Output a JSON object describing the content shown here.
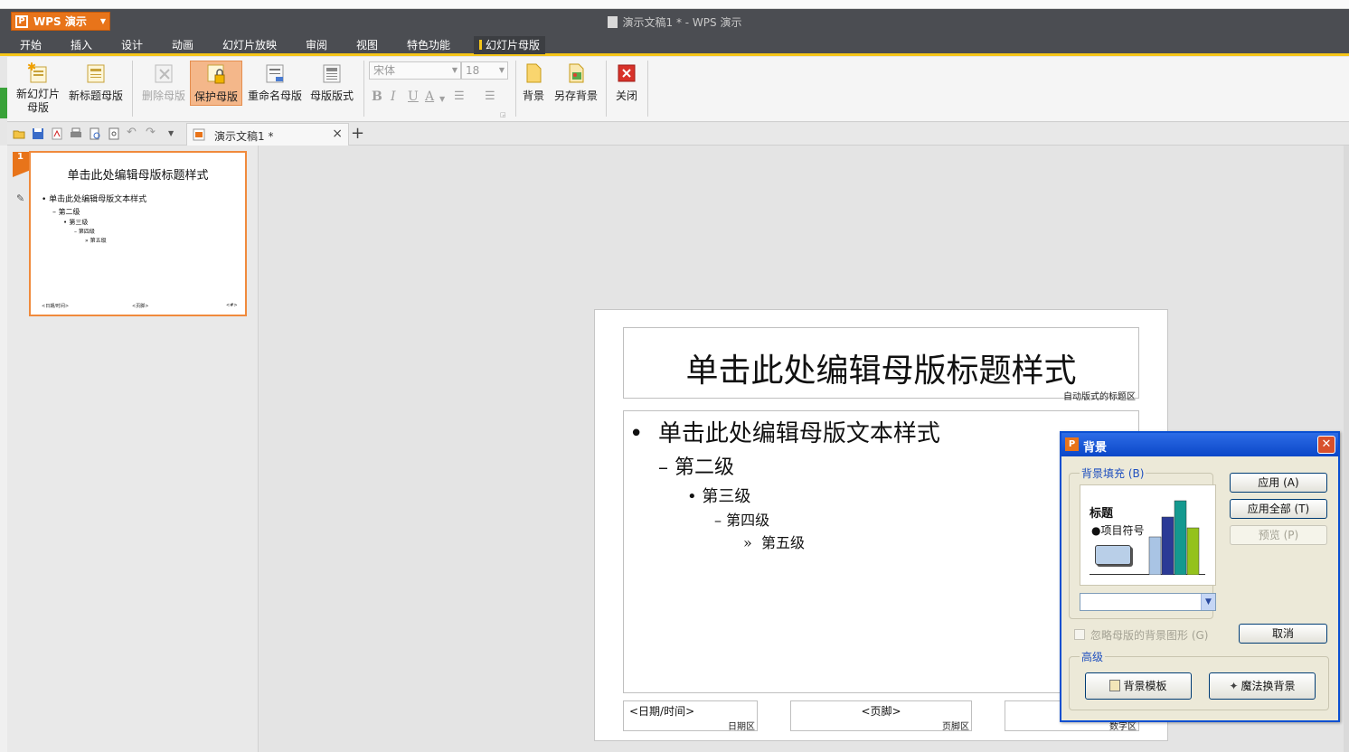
{
  "app": {
    "name": "WPS 演示",
    "window_title": "演示文稿1 * - WPS 演示"
  },
  "menu": {
    "tabs": [
      "开始",
      "插入",
      "设计",
      "动画",
      "幻灯片放映",
      "审阅",
      "视图",
      "特色功能",
      "幻灯片母版"
    ],
    "active_tab": "幻灯片母版"
  },
  "ribbon": {
    "new_slide_master": "新幻灯片母版",
    "new_title_master": "新标题母版",
    "delete_master": "删除母版",
    "protect_master": "保护母版",
    "rename_master": "重命名母版",
    "master_layout": "母版版式",
    "font_name": "宋体",
    "font_size": "18",
    "bold": "B",
    "italic": "I",
    "underline": "U",
    "font_color": "A",
    "background": "背景",
    "save_background": "另存背景",
    "close": "关闭"
  },
  "doc_tab": {
    "label": "演示文稿1 *",
    "close": "×",
    "add": "+"
  },
  "thumbnail": {
    "number": "1",
    "title": "单击此处编辑母版标题样式",
    "level1": "单击此处编辑母版文本样式",
    "level2": "第二级",
    "level3": "第三级",
    "level4": "第四级",
    "level5": "第五级",
    "foot_date": "<日期/时间>",
    "foot_footer": "<页脚>",
    "foot_num": "<#>"
  },
  "slide": {
    "title": "单击此处编辑母版标题样式",
    "title_area_label": "自动版式的标题区",
    "level1": "单击此处编辑母版文本样式",
    "level2": "第二级",
    "level3": "第三级",
    "level4": "第四级",
    "level5": "第五级",
    "date_text": "<日期/时间>",
    "date_label": "日期区",
    "footer_text": "<页脚>",
    "footer_label": "页脚区",
    "number_label": "数字区"
  },
  "dialog": {
    "title": "背景",
    "fill_group": "背景填充 (B)",
    "preview_title": "标题",
    "preview_bullet": "●项目符号",
    "apply": "应用 (A)",
    "apply_all": "应用全部 (T)",
    "preview": "预览 (P)",
    "ignore_master": "忽略母版的背景图形 (G)",
    "cancel": "取消",
    "advanced_group": "高级",
    "bg_template": "背景模板",
    "magic_bg": "魔法换背景"
  },
  "chart_preview_colors": [
    "#a9c4e4",
    "#2b3a96",
    "#14998f",
    "#94c21c"
  ]
}
